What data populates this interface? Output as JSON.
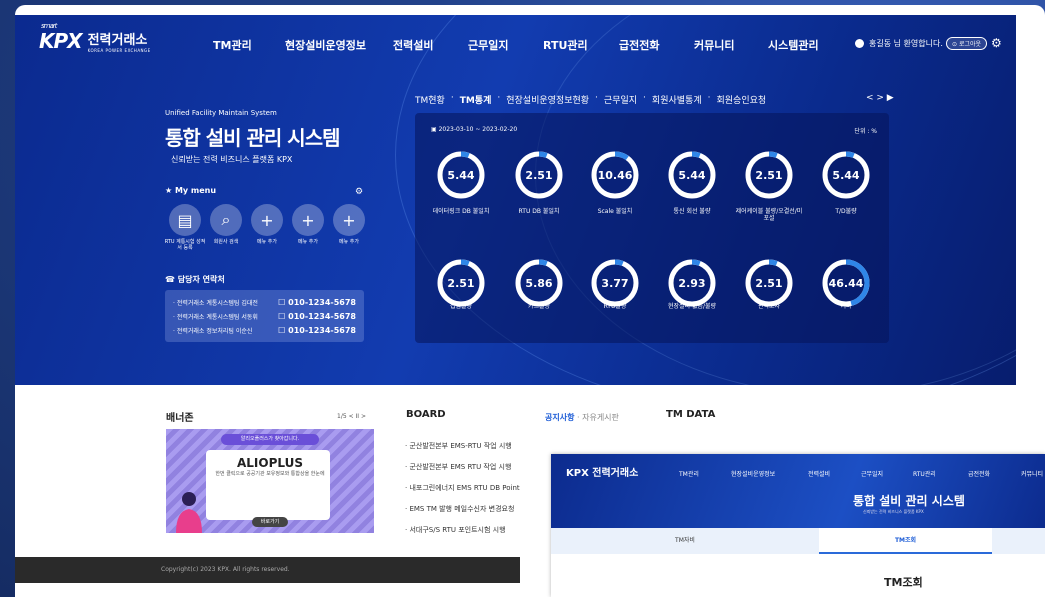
{
  "header": {
    "logo_smart": "smart",
    "logo_kpx": "KPX",
    "logo_name": "전력거래소",
    "logo_sub": "KOREA POWER EXCHANGE",
    "menu": [
      "TM관리",
      "현장설비운영정보",
      "전력설비",
      "근무일지",
      "RTU관리",
      "급전전화",
      "커뮤니티",
      "시스템관리"
    ],
    "welcome": "홍길동 님 환영합니다.",
    "logout": "로그아웃"
  },
  "hero": {
    "subtitle": "Unified Facility Maintain System",
    "title": "통합 설비 관리 시스템",
    "tagline": "신뢰받는 전력 비즈니스 플랫폼 KPX",
    "mymenu_label": "★ My menu",
    "mymenu_items": [
      "RTU 계통시험 성적서 등록",
      "회원사 검색",
      "메뉴 추가",
      "메뉴 추가",
      "메뉴 추가"
    ],
    "contact_label": "담당자 연락처",
    "contacts": [
      {
        "name": "· 전력거래소 계통시스템팀 김대전",
        "phone": "010-1234-5678"
      },
      {
        "name": "· 전력거래소 계통시스템팀 서동휘",
        "phone": "010-1234-5678"
      },
      {
        "name": "· 전력거래소 정보처리팀 이순신",
        "phone": "010-1234-5678"
      }
    ]
  },
  "tm": {
    "tabs": [
      "TM현황",
      "TM통계",
      "현장설비운영정보현황",
      "근무일지",
      "회원사별통계",
      "회원승인요청"
    ],
    "active_tab": "TM통계",
    "pager": "< > ▶",
    "period": "2023-03-10 ~ 2023-02-20",
    "unit": "단위 : %",
    "stats": [
      {
        "value": "5.44",
        "label": "데이터링크 DB 불일치",
        "pct": 0.06
      },
      {
        "value": "2.51",
        "label": "RTU DB 불일치",
        "pct": 0.06
      },
      {
        "value": "10.46",
        "label": "Scale 불일치",
        "pct": 0.1
      },
      {
        "value": "5.44",
        "label": "통신 회선 불량",
        "pct": 0.06
      },
      {
        "value": "2.51",
        "label": "제어케이블 불량/오결선/미포설",
        "pct": 0.06
      },
      {
        "value": "5.44",
        "label": "T/D불량",
        "pct": 0.06
      },
      {
        "value": "2.51",
        "label": "접점불량",
        "pct": 0.06
      },
      {
        "value": "5.86",
        "label": "카드불량",
        "pct": 0.06
      },
      {
        "value": "3.77",
        "label": "RTU불량",
        "pct": 0.06
      },
      {
        "value": "2.93",
        "label": "현장설비 없음/불량",
        "pct": 0.06
      },
      {
        "value": "2.51",
        "label": "판독오차",
        "pct": 0.06
      },
      {
        "value": "46.44",
        "label": "기타",
        "pct": 0.46
      }
    ],
    "colors": {
      "ring_bg": "#ffffff",
      "ring_fg": "#2f86e8"
    }
  },
  "bottom": {
    "banner_title": "배너존",
    "banner_nav": "1/5 < II >",
    "banner_pill": "알리오플러스가 찾아갑니다.",
    "banner_brand": "ALIOPLUS",
    "banner_desc": "한번 클릭으로 공공기관 보유정보와 통합상을 한눈에",
    "banner_btn": "바로가기",
    "board_title": "BOARD",
    "board_tab_active": "공지사항",
    "board_tab_other": "자유게시판",
    "board_items": [
      "· 군산발전본부 EMS-RTU 작업 시행",
      "· 군산발전본부 EMS RTU 작업 시행",
      "· 내포그린에너지 EMS RTU DB Point",
      "· EMS TM 발행 메일수신자 변경요청",
      "· 서대구S/S RTU 포인트시험 시행"
    ],
    "tmdata_title": "TM DATA",
    "footer": "Copyright(c) 2023 KPX. All rights reserved."
  },
  "popup": {
    "logo": "KPX 전력거래소",
    "menu": [
      "TM관리",
      "현장설비운영정보",
      "전력설비",
      "근무일지",
      "RTU관리",
      "급전전화",
      "커뮤니티"
    ],
    "title": "통합 설비 관리 시스템",
    "tagline": "신뢰받는 전력 비즈니스 플랫폼 KPX",
    "tabs": [
      "TM자비",
      "TM조회"
    ],
    "heading": "TM조회"
  }
}
